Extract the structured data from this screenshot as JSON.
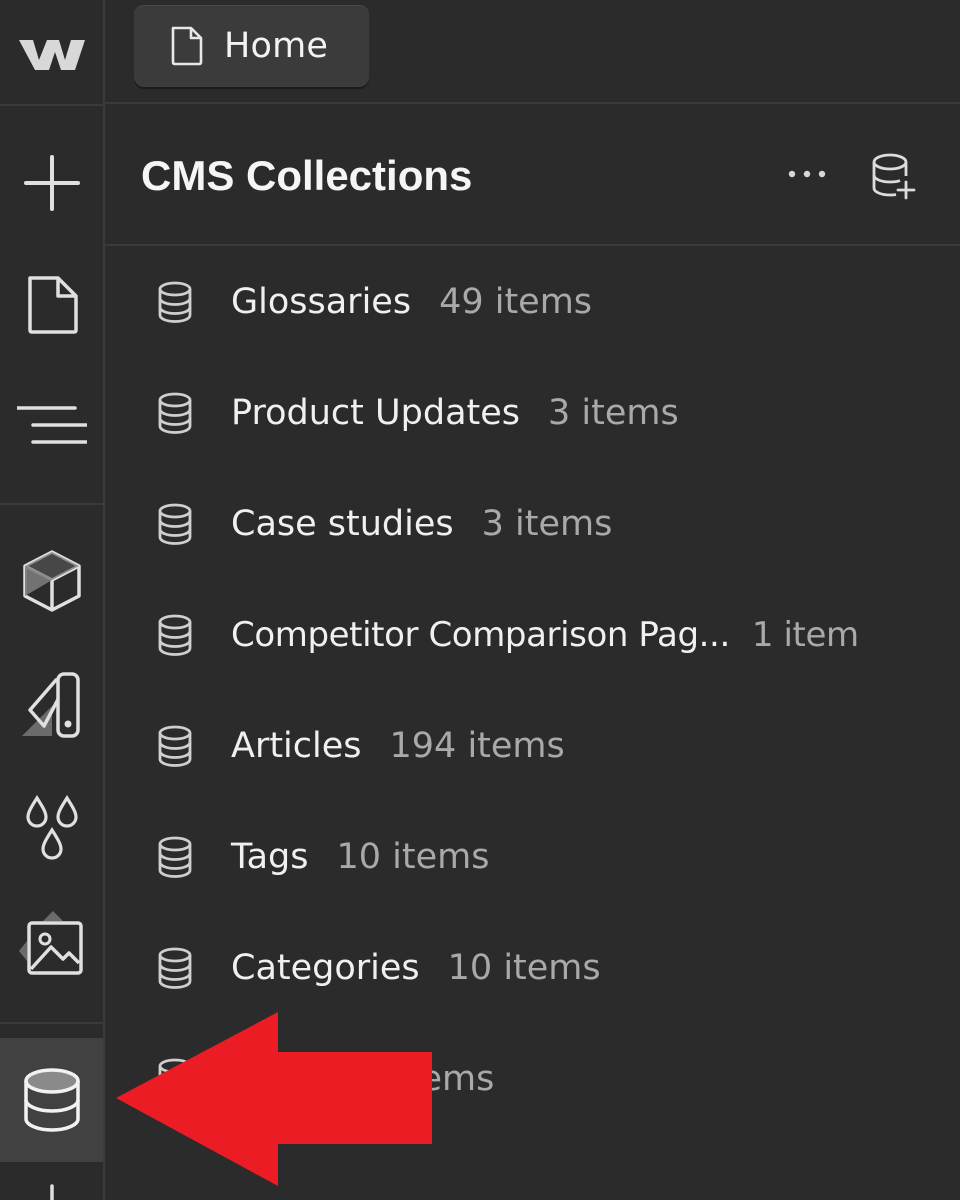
{
  "top_tab": {
    "label": "Home",
    "icon": "page-icon"
  },
  "panel": {
    "title": "CMS Collections",
    "more_icon": "ellipsis-icon",
    "add_icon": "database-add-icon"
  },
  "rail": {
    "items": [
      {
        "icon": "webflow-logo"
      },
      {
        "icon": "plus-icon"
      },
      {
        "icon": "page-icon"
      },
      {
        "icon": "navigator-icon"
      },
      {
        "icon": "components-icon"
      },
      {
        "icon": "style-guide-icon"
      },
      {
        "icon": "variables-icon"
      },
      {
        "icon": "assets-icon"
      },
      {
        "icon": "cms-database-icon",
        "active": true
      },
      {
        "icon": "plus-icon"
      }
    ]
  },
  "collections": [
    {
      "name": "Glossaries",
      "count": "49 items"
    },
    {
      "name": "Product Updates",
      "count": "3 items"
    },
    {
      "name": "Case studies",
      "count": "3 items"
    },
    {
      "name": "Competitor Comparison Pag...",
      "count": "1 item"
    },
    {
      "name": "Articles",
      "count": "194 items"
    },
    {
      "name": "Tags",
      "count": "10 items"
    },
    {
      "name": "Categories",
      "count": "10 items"
    },
    {
      "name": "",
      "count": "items"
    }
  ],
  "colors": {
    "background": "#2b2b2b",
    "divider": "#3b3b3b",
    "active_rail": "#414141",
    "text_primary": "#f0f0f0",
    "text_secondary": "#a9a9a9",
    "annotation_arrow": "#ec1c24"
  }
}
